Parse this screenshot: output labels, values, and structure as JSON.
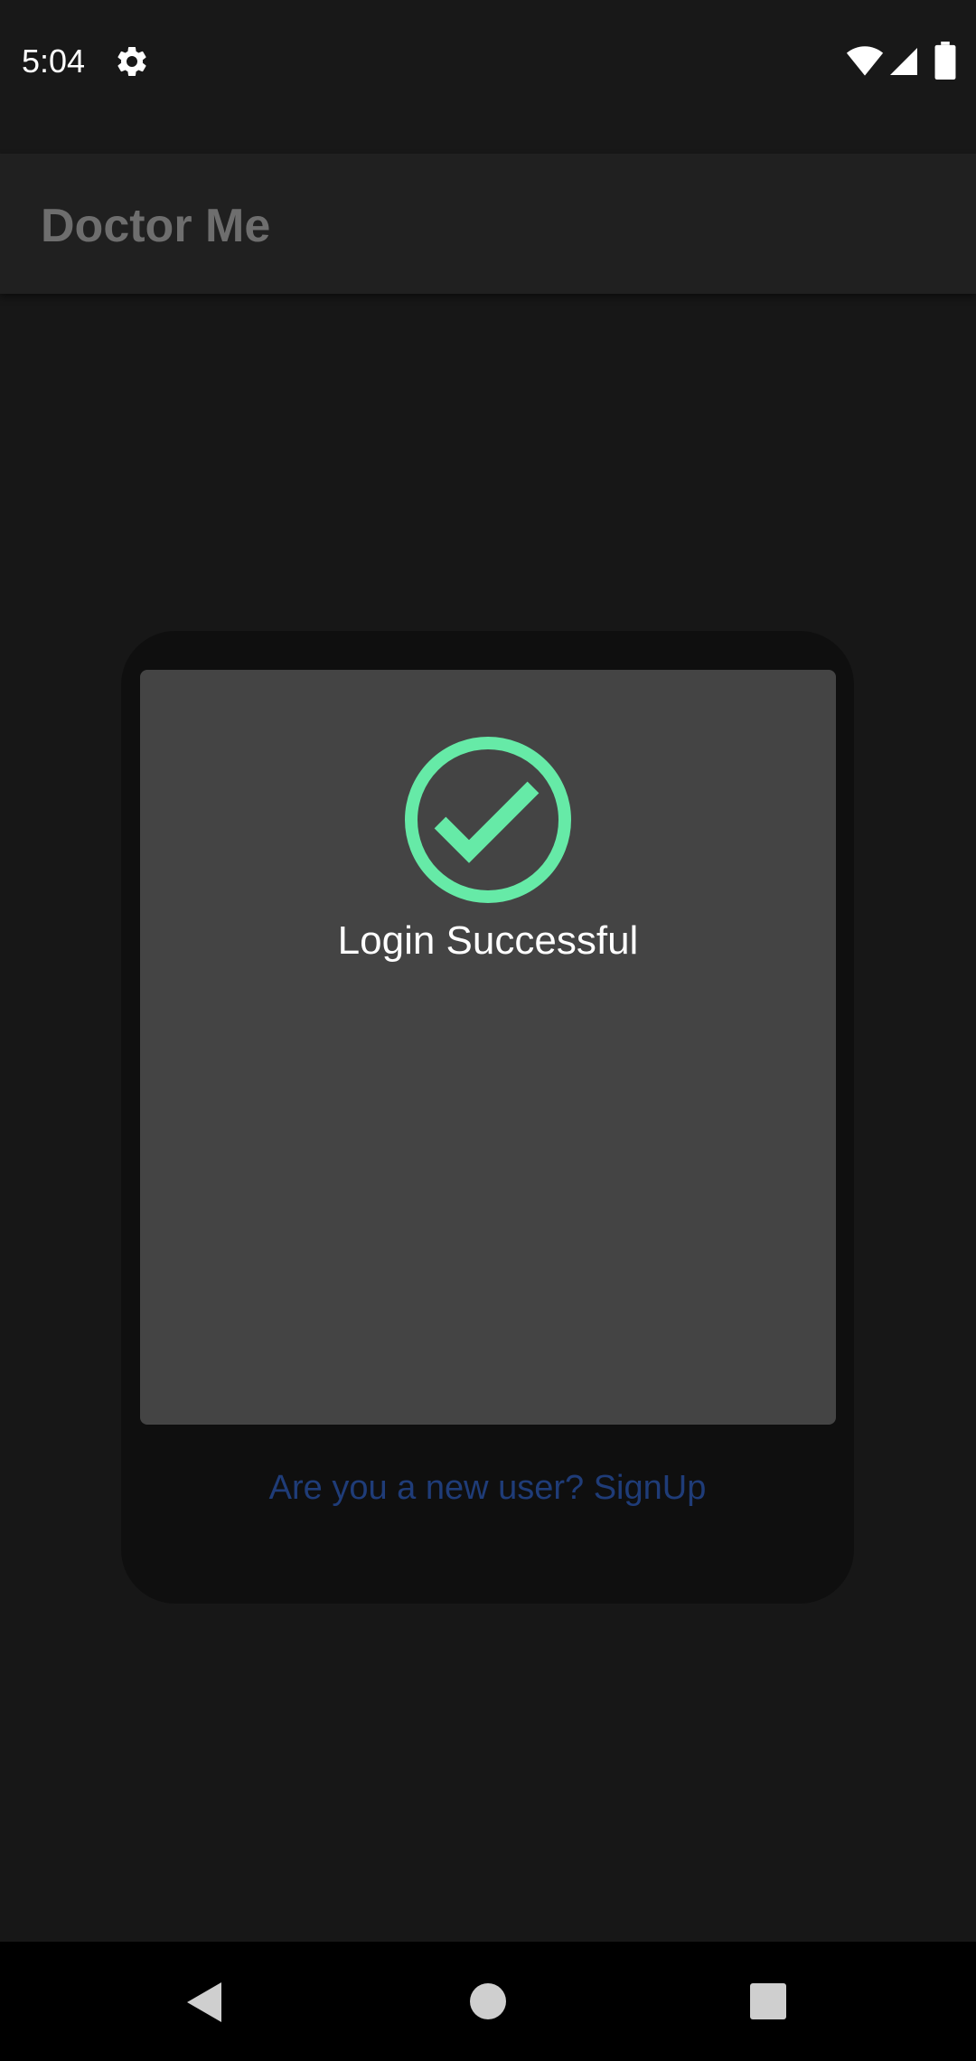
{
  "status_bar": {
    "time": "5:04",
    "icons": [
      "gear-icon",
      "wifi-icon",
      "signal-icon",
      "battery-icon"
    ]
  },
  "app_bar": {
    "title": "Doctor Me"
  },
  "login_card": {
    "signup_link": "Are you a new user? SignUp"
  },
  "dialog": {
    "icon": "check-circle-icon",
    "message": "Login Successful"
  },
  "nav_bar": {
    "icons": [
      "back-icon",
      "home-icon",
      "recents-icon"
    ]
  },
  "colors": {
    "background": "#171717",
    "app_bar": "#202020",
    "dialog": "#444444",
    "success": "#66EAA7",
    "link": "#1F3C78"
  }
}
